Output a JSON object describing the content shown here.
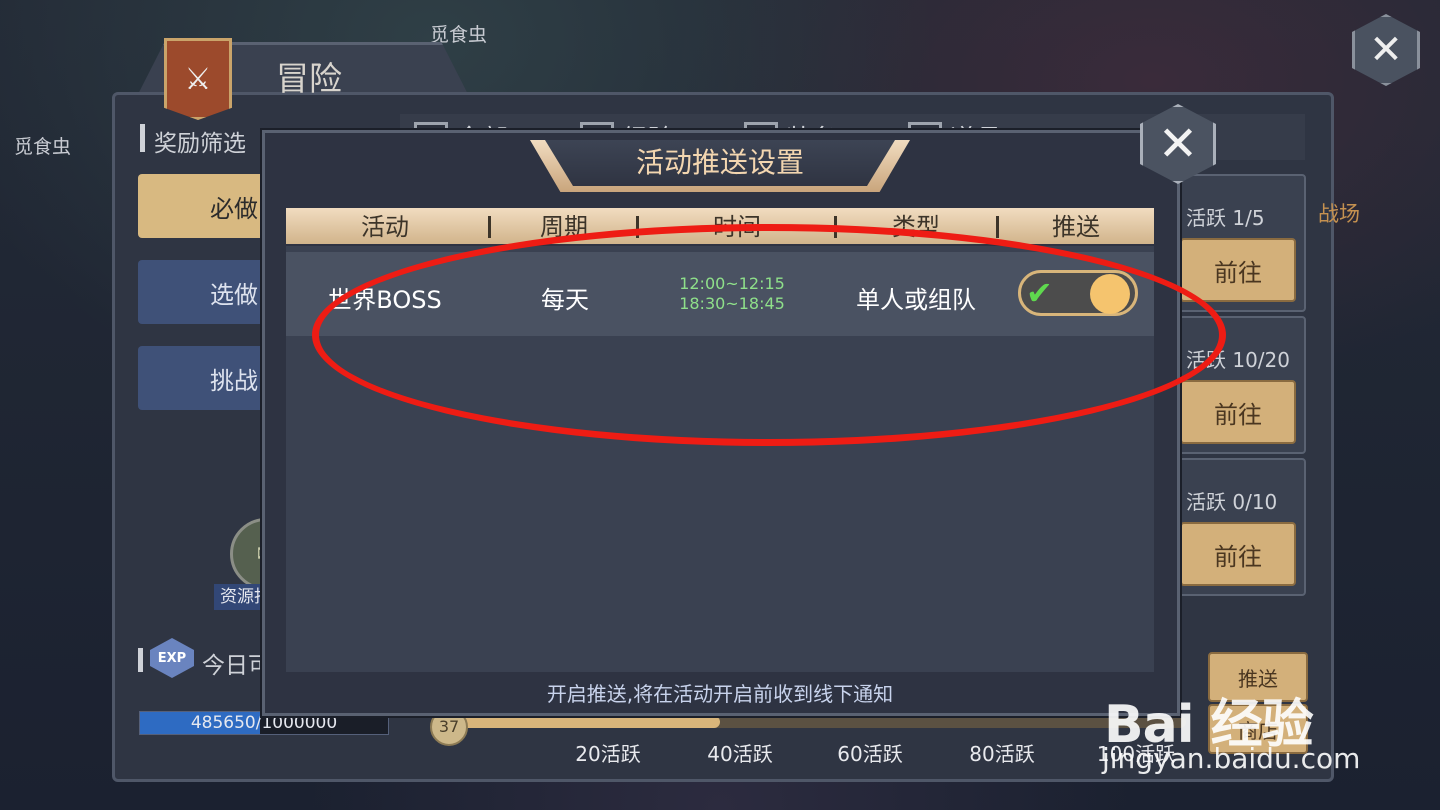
{
  "scene": {
    "top_label": "觅食虫",
    "left_label": "觅食虫",
    "corner_close_icon": "close-icon"
  },
  "adventure": {
    "title": "冒险",
    "filter_label": "奖励筛选",
    "filters": [
      "全部",
      "经验",
      "装备",
      "道具"
    ],
    "left_buttons": [
      "必做",
      "选做",
      "挑战"
    ],
    "resource_label": "资源找回",
    "today_label": "今日可获",
    "exp_badge": "EXP",
    "exp_text": "485650/1000000",
    "exp_progress": 0.48565,
    "level": "37",
    "milestones": [
      "20活跃",
      "40活跃",
      "60活跃",
      "80活跃",
      "100活跃"
    ],
    "right_cards": [
      {
        "label": "活跃 1/5",
        "button": "前往"
      },
      {
        "label": "活跃 10/20",
        "button": "前往"
      },
      {
        "label": "活跃 0/10",
        "button": "前往"
      }
    ],
    "side_label": "战场",
    "bottom_btns": [
      "推送",
      "商店"
    ]
  },
  "modal": {
    "title": "活动推送设置",
    "headers": [
      "活动",
      "周期",
      "时间",
      "类型",
      "推送"
    ],
    "rows": [
      {
        "activity": "世界BOSS",
        "cycle": "每天",
        "time1": "12:00~12:15",
        "time2": "18:30~18:45",
        "type": "单人或组队",
        "push_on": true
      }
    ],
    "footer": "开启推送,将在活动开启前收到线下通知"
  },
  "watermark": {
    "logo": "Bai 经验",
    "url": "jingyan.baidu.com"
  },
  "colors": {
    "accent_gold": "#d8b57a",
    "toggle_check": "#5fd84e",
    "time_green": "#8fe08a",
    "annotation_red": "#ee1c14"
  }
}
